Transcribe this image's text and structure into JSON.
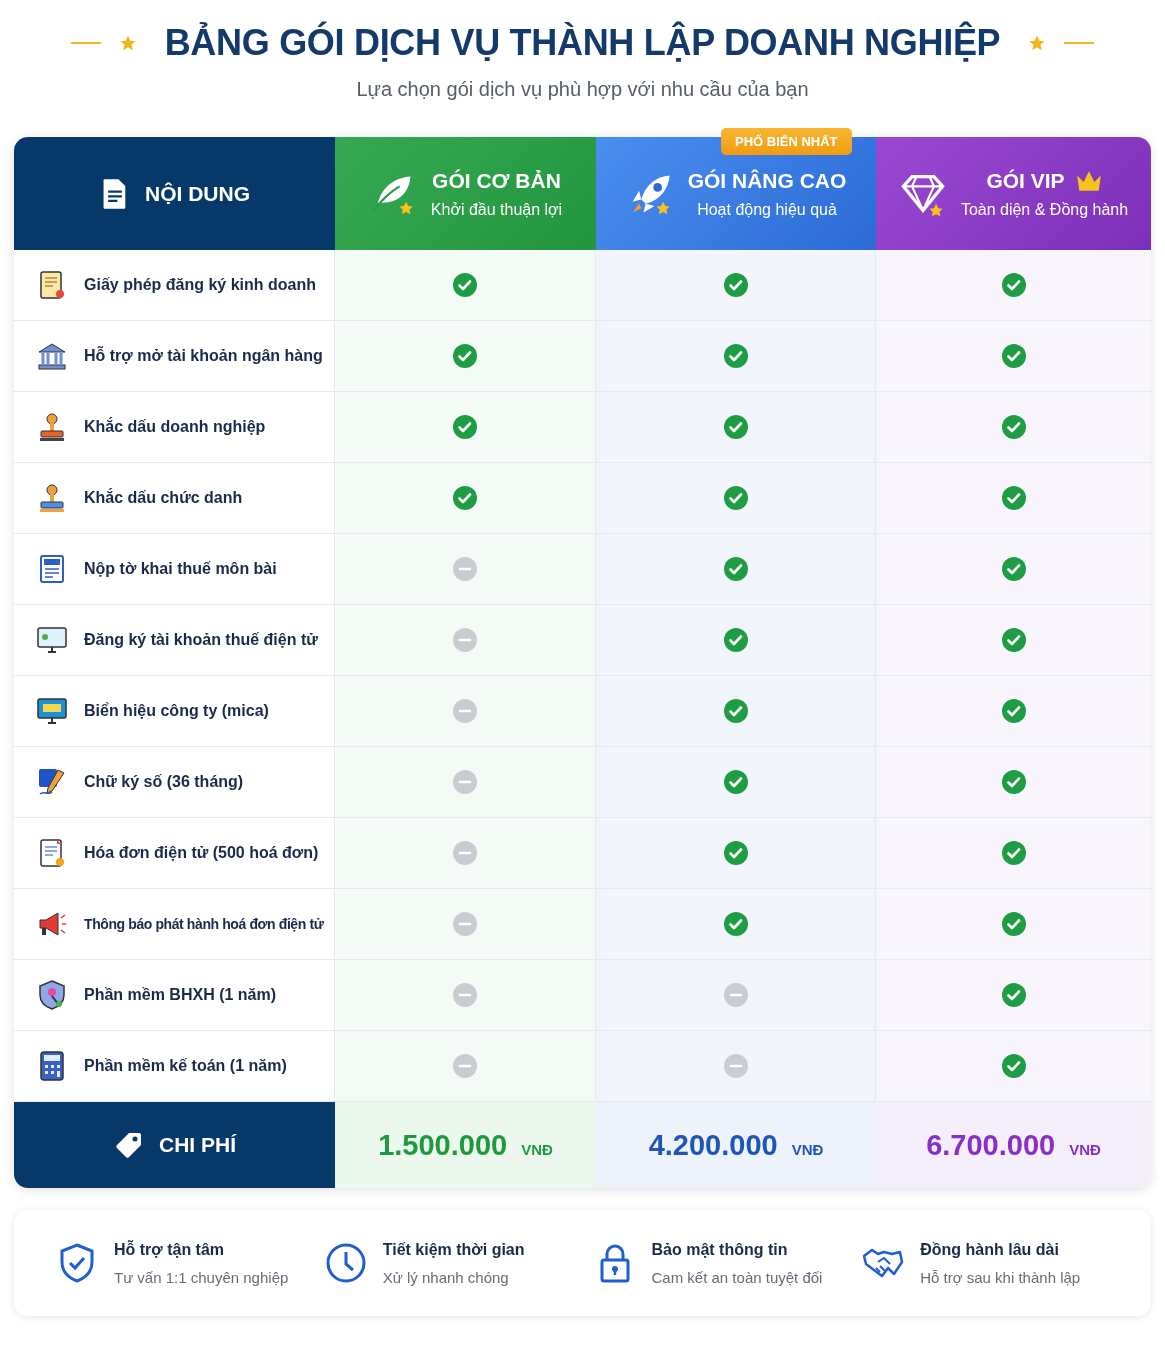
{
  "title": "BẢNG GÓI DỊCH VỤ THÀNH LẬP DOANH NGHIỆP",
  "subtitle": "Lựa chọn gói dịch vụ phù hợp với nhu cầu của bạn",
  "table": {
    "first_column": "NỘI DUNG",
    "plans": [
      {
        "kind": "basic",
        "name": "GÓI CƠ BẢN",
        "tagline": "Khởi đầu thuận lợi",
        "price": "1.500.000",
        "currency": "VNĐ"
      },
      {
        "kind": "advanced",
        "name": "GÓI NÂNG CAO",
        "tagline": "Hoạt động hiệu quả",
        "price": "4.200.000",
        "currency": "VNĐ",
        "badge": "PHỔ BIẾN NHẤT"
      },
      {
        "kind": "vip",
        "name": "GÓI VIP",
        "tagline": "Toàn diện & Đồng hành",
        "price": "6.700.000",
        "currency": "VNĐ"
      }
    ],
    "rows": [
      {
        "feature": "Giấy phép đăng ký kinh doanh",
        "included": [
          true,
          true,
          true
        ]
      },
      {
        "feature": "Hỗ trợ mở tài khoản ngân hàng",
        "included": [
          true,
          true,
          true
        ]
      },
      {
        "feature": "Khắc dấu doanh nghiệp",
        "included": [
          true,
          true,
          true
        ]
      },
      {
        "feature": "Khắc dấu chức danh",
        "included": [
          true,
          true,
          true
        ]
      },
      {
        "feature": "Nộp tờ khai thuế môn bài",
        "included": [
          false,
          true,
          true
        ]
      },
      {
        "feature": "Đăng ký tài khoản thuế điện tử",
        "included": [
          false,
          true,
          true
        ]
      },
      {
        "feature": "Biển hiệu công ty (mica)",
        "included": [
          false,
          true,
          true
        ]
      },
      {
        "feature": "Chữ ký số (36 tháng)",
        "included": [
          false,
          true,
          true
        ]
      },
      {
        "feature": "Hóa đơn điện tử (500 hoá đơn)",
        "included": [
          false,
          true,
          true
        ]
      },
      {
        "feature": "Thông báo phát hành hoá đơn điện tử",
        "included": [
          false,
          true,
          true
        ]
      },
      {
        "feature": "Phần mềm BHXH (1 năm)",
        "included": [
          false,
          false,
          true
        ]
      },
      {
        "feature": "Phần mềm kế toán (1 năm)",
        "included": [
          false,
          false,
          true
        ]
      }
    ],
    "cost_label": "CHI PHÍ"
  },
  "benefits": [
    {
      "title": "Hỗ trợ tận tâm",
      "text": "Tư vấn 1:1 chuyên nghiệp"
    },
    {
      "title": "Tiết kiệm thời gian",
      "text": "Xử lý nhanh chóng"
    },
    {
      "title": "Bảo mật thông tin",
      "text": "Cam kết an toàn tuyệt đối"
    },
    {
      "title": "Đồng hành lâu dài",
      "text": "Hỗ trợ sau khi thành lập"
    }
  ]
}
